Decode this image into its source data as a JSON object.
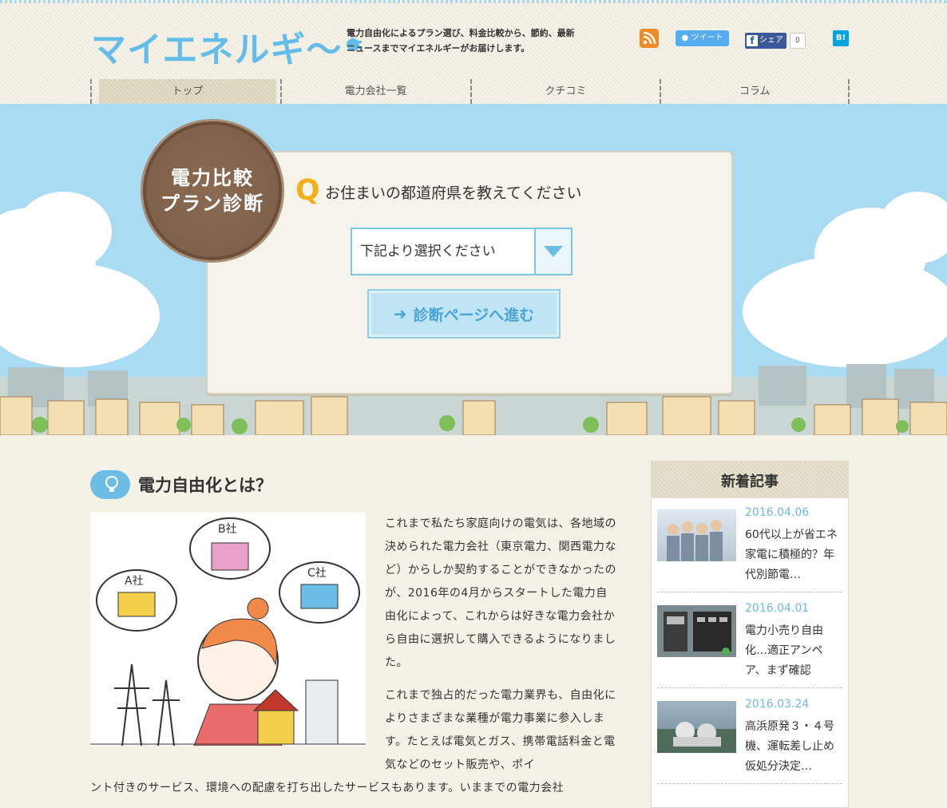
{
  "site": {
    "logo_text": "マイエネルギ〜",
    "tagline": "電力自由化によるプラン選び、料金比較から、節約、最新ニュースまでマイエネルギーがお届けします。"
  },
  "social": {
    "tweet_label": "ツイート",
    "share_label": "シェア",
    "share_count": "0",
    "hatena_label": "B!"
  },
  "nav": {
    "items": [
      {
        "label": "トップ"
      },
      {
        "label": "電力会社一覧"
      },
      {
        "label": "クチコミ"
      },
      {
        "label": "コラム"
      }
    ]
  },
  "diagnosis": {
    "badge_line1": "電力比較",
    "badge_line2": "プラン診断",
    "q_mark": "Q",
    "question": "お住まいの都道府県を教えてください",
    "select_value": "下記より選択ください",
    "go_label": "診断ページへ進む"
  },
  "main": {
    "heading": "電力自由化とは？",
    "illus_labels": {
      "a": "A社",
      "b": "B社",
      "c": "C社"
    },
    "p1": "これまで私たち家庭向けの電気は、各地域の決められた電力会社（東京電力、関西電力など）からしか契約することができなかったのが、2016年の4月からスタートした電力自由化によって、これからは好きな電力会社から自由に選択して購入できるようになりました。",
    "p2": "これまで独占的だった電力業界も、自由化によりさまざまな業種が電力事業に参入します。たとえば電気とガス、携帯電話料金と電気などのセット販売や、ポイ",
    "p2b": "ント付きのサービス、環境への配慮を打ち出したサービスもあります。いままでの電力会社"
  },
  "sidebar": {
    "heading": "新着記事",
    "articles": [
      {
        "date": "2016.04.06",
        "title": "60代以上が省エネ家電に積極的？年代別節電…"
      },
      {
        "date": "2016.04.01",
        "title": "電力小売り自由化…適正アンペア、まず確認"
      },
      {
        "date": "2016.03.24",
        "title": "高浜原発３・４号機、運転差し止め仮処分決定…"
      }
    ]
  },
  "colors": {
    "accent_blue": "#64bde8",
    "badge_brown": "#7a5c44",
    "q_yellow": "#f4b01a",
    "sky": "#a9dbf2"
  }
}
